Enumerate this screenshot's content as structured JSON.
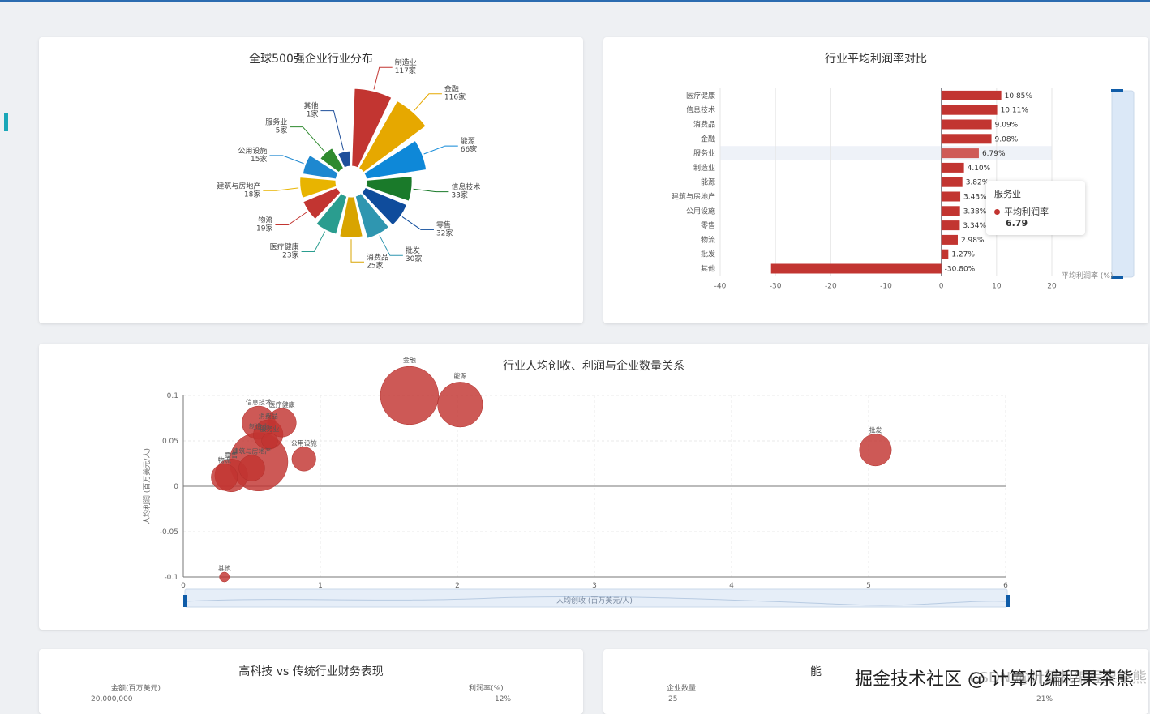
{
  "panels": {
    "pie_title": "全球500强企业行业分布",
    "bar_title": "行业平均利润率对比",
    "bubble_title": "行业人均创收、利润与企业数量关系",
    "tech_title": "高科技 vs 传统行业财务表现",
    "tech_left_axis": "金额(百万美元)",
    "tech_right_axis": "利润率(%)",
    "tech_left_tick": "20,000,000",
    "tech_right_tick": "12%",
    "bottom_right_title_partial": "能",
    "bottom_right_left_axis": "企业数量",
    "bottom_right_left_tick": "25",
    "bottom_right_right_tick": "21%"
  },
  "tooltip": {
    "industry": "服务业",
    "series": "平均利润率",
    "value": "6.79"
  },
  "bar_legend": "平均利润率 (%)",
  "watermark": "掘金技术社区 @ 计算机编程果茶熊",
  "watermark_faint": "CSDN @计算机编程果茶熊",
  "colors": {
    "accent": "#c23531",
    "bar": "#c23531",
    "bubble": "#c9413d"
  },
  "chart_data": [
    {
      "type": "pie",
      "subtype": "rose",
      "title": "全球500强企业行业分布",
      "unit": "家",
      "slices": [
        {
          "name": "制造业",
          "value": 117,
          "color": "#c23531"
        },
        {
          "name": "金融",
          "value": 116,
          "color": "#e6a800"
        },
        {
          "name": "能源",
          "value": 66,
          "color": "#0e88d8"
        },
        {
          "name": "信息技术",
          "value": 33,
          "color": "#1a7a2a"
        },
        {
          "name": "零售",
          "value": 32,
          "color": "#0f4c9c"
        },
        {
          "name": "批发",
          "value": 30,
          "color": "#2f96b0"
        },
        {
          "name": "消费品",
          "value": 25,
          "color": "#d8a400"
        },
        {
          "name": "医疗健康",
          "value": 23,
          "color": "#2a9d8f"
        },
        {
          "name": "物流",
          "value": 19,
          "color": "#c23531"
        },
        {
          "name": "建筑与房地产",
          "value": 18,
          "color": "#e8b400"
        },
        {
          "name": "公用设施",
          "value": 15,
          "color": "#1e88d0"
        },
        {
          "name": "服务业",
          "value": 5,
          "color": "#2f8a2f"
        },
        {
          "name": "其他",
          "value": 1,
          "color": "#1f4f9a"
        }
      ]
    },
    {
      "type": "bar",
      "orientation": "horizontal",
      "title": "行业平均利润率对比",
      "series_name": "平均利润率 (%)",
      "categories": [
        "医疗健康",
        "信息技术",
        "消费品",
        "金融",
        "服务业",
        "制造业",
        "能源",
        "建筑与房地产",
        "公用设施",
        "零售",
        "物流",
        "批发",
        "其他"
      ],
      "values": [
        10.85,
        10.11,
        9.09,
        9.08,
        6.79,
        4.1,
        3.82,
        3.43,
        3.38,
        3.34,
        2.98,
        1.27,
        -30.8
      ],
      "labels": [
        "10.85%",
        "10.11%",
        "9.09%",
        "9.08%",
        "6.79%",
        "4.10%",
        "3.82%",
        "3.43%",
        "3.38%",
        "3.34%",
        "2.98%",
        "1.27%",
        "-30.80%"
      ],
      "xlim": [
        -40,
        20
      ],
      "xticks": [
        "-40",
        "-30",
        "-20",
        "-10",
        "0",
        "10",
        "20"
      ],
      "highlight": "服务业"
    },
    {
      "type": "scatter",
      "subtype": "bubble",
      "title": "行业人均创收、利润与企业数量关系",
      "xlabel": "人均创收 (百万美元/人)",
      "ylabel": "人均利润 (百万美元/人)",
      "xlim": [
        0,
        6
      ],
      "ylim": [
        -0.1,
        0.1
      ],
      "xticks": [
        "0",
        "1",
        "2",
        "3",
        "4",
        "5",
        "6"
      ],
      "yticks": [
        "0.1",
        "0.05",
        "0",
        "-0.05",
        "-0.1"
      ],
      "size_field": "企业数量",
      "points": [
        {
          "name": "金融",
          "x": 1.65,
          "y": 0.1,
          "size": 116
        },
        {
          "name": "能源",
          "x": 2.02,
          "y": 0.09,
          "size": 66
        },
        {
          "name": "批发",
          "x": 5.05,
          "y": 0.04,
          "size": 30
        },
        {
          "name": "信息技术",
          "x": 0.55,
          "y": 0.07,
          "size": 33
        },
        {
          "name": "医疗健康",
          "x": 0.72,
          "y": 0.07,
          "size": 23
        },
        {
          "name": "消费品",
          "x": 0.62,
          "y": 0.057,
          "size": 25
        },
        {
          "name": "服务业",
          "x": 0.63,
          "y": 0.05,
          "size": 5
        },
        {
          "name": "制造业",
          "x": 0.55,
          "y": 0.027,
          "size": 117
        },
        {
          "name": "公用设施",
          "x": 0.88,
          "y": 0.03,
          "size": 15
        },
        {
          "name": "建筑与房地产",
          "x": 0.5,
          "y": 0.02,
          "size": 18
        },
        {
          "name": "零售",
          "x": 0.35,
          "y": 0.012,
          "size": 32
        },
        {
          "name": "物流",
          "x": 0.3,
          "y": 0.01,
          "size": 19
        },
        {
          "name": "其他",
          "x": 0.3,
          "y": -0.1,
          "size": 1
        }
      ]
    }
  ]
}
